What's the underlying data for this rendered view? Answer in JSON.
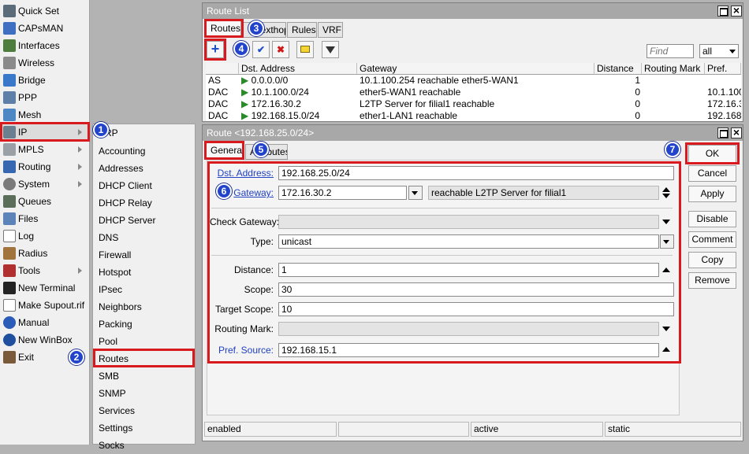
{
  "main_menu": [
    {
      "label": "Quick Set",
      "icon": "quickset-icon"
    },
    {
      "label": "CAPsMAN",
      "icon": "capsman-icon"
    },
    {
      "label": "Interfaces",
      "icon": "interfaces-icon"
    },
    {
      "label": "Wireless",
      "icon": "wireless-icon"
    },
    {
      "label": "Bridge",
      "icon": "bridge-icon"
    },
    {
      "label": "PPP",
      "icon": "ppp-icon"
    },
    {
      "label": "Mesh",
      "icon": "mesh-icon"
    },
    {
      "label": "IP",
      "icon": "ip-icon"
    },
    {
      "label": "MPLS",
      "icon": "mpls-icon"
    },
    {
      "label": "Routing",
      "icon": "routing-icon"
    },
    {
      "label": "System",
      "icon": "system-icon"
    },
    {
      "label": "Queues",
      "icon": "queues-icon"
    },
    {
      "label": "Files",
      "icon": "files-icon"
    },
    {
      "label": "Log",
      "icon": "log-icon"
    },
    {
      "label": "Radius",
      "icon": "radius-icon"
    },
    {
      "label": "Tools",
      "icon": "tools-icon"
    },
    {
      "label": "New Terminal",
      "icon": "terminal-icon"
    },
    {
      "label": "Make Supout.rif",
      "icon": "supout-icon"
    },
    {
      "label": "Manual",
      "icon": "manual-icon"
    },
    {
      "label": "New WinBox",
      "icon": "winbox-icon"
    },
    {
      "label": "Exit",
      "icon": "exit-icon"
    }
  ],
  "ip_submenu": [
    "ARP",
    "Accounting",
    "Addresses",
    "DHCP Client",
    "DHCP Relay",
    "DHCP Server",
    "DNS",
    "Firewall",
    "Hotspot",
    "IPsec",
    "Neighbors",
    "Packing",
    "Pool",
    "Routes",
    "SMB",
    "SNMP",
    "Services",
    "Settings",
    "Socks"
  ],
  "route_list": {
    "title": "Route List",
    "tabs": [
      "Routes",
      "Nexthops",
      "Rules",
      "VRF"
    ],
    "find_placeholder": "Find",
    "filter_value": "all",
    "columns": [
      "Dst. Address",
      "Gateway",
      "Distance",
      "Routing Mark",
      "Pref."
    ],
    "rows": [
      {
        "flags": "AS",
        "dst": "0.0.0.0/0",
        "gateway": "10.1.100.254 reachable ether5-WAN1",
        "distance": "1",
        "routing_mark": "",
        "pref": ""
      },
      {
        "flags": "DAC",
        "dst": "10.1.100.0/24",
        "gateway": "ether5-WAN1 reachable",
        "distance": "0",
        "routing_mark": "",
        "pref": "10.1.100"
      },
      {
        "flags": "DAC",
        "dst": "172.16.30.2",
        "gateway": "L2TP Server for filial1 reachable",
        "distance": "0",
        "routing_mark": "",
        "pref": "172.16.3"
      },
      {
        "flags": "DAC",
        "dst": "192.168.15.0/24",
        "gateway": "ether1-LAN1 reachable",
        "distance": "0",
        "routing_mark": "",
        "pref": "192.168.1"
      }
    ]
  },
  "route_dialog": {
    "title": "Route <192.168.25.0/24>",
    "tabs": [
      "General",
      "Attributes"
    ],
    "fields": {
      "dst_address": {
        "label": "Dst. Address:",
        "value": "192.168.25.0/24"
      },
      "gateway": {
        "label": "Gateway:",
        "value": "172.16.30.2",
        "status": "reachable L2TP Server for filial1"
      },
      "check_gateway": {
        "label": "Check Gateway:",
        "value": ""
      },
      "type": {
        "label": "Type:",
        "value": "unicast"
      },
      "distance": {
        "label": "Distance:",
        "value": "1"
      },
      "scope": {
        "label": "Scope:",
        "value": "30"
      },
      "target_scope": {
        "label": "Target Scope:",
        "value": "10"
      },
      "routing_mark": {
        "label": "Routing Mark:",
        "value": ""
      },
      "pref_source": {
        "label": "Pref. Source:",
        "value": "192.168.15.1"
      }
    },
    "buttons": {
      "ok": "OK",
      "cancel": "Cancel",
      "apply": "Apply",
      "disable": "Disable",
      "comment": "Comment",
      "copy": "Copy",
      "remove": "Remove"
    },
    "status_bar": [
      "enabled",
      "",
      "active",
      "static"
    ]
  },
  "steps": [
    "1",
    "2",
    "3",
    "4",
    "5",
    "6",
    "7"
  ],
  "colors": {
    "highlight": "#d8191e",
    "badge": "#2244cc",
    "link": "#2040c0"
  }
}
